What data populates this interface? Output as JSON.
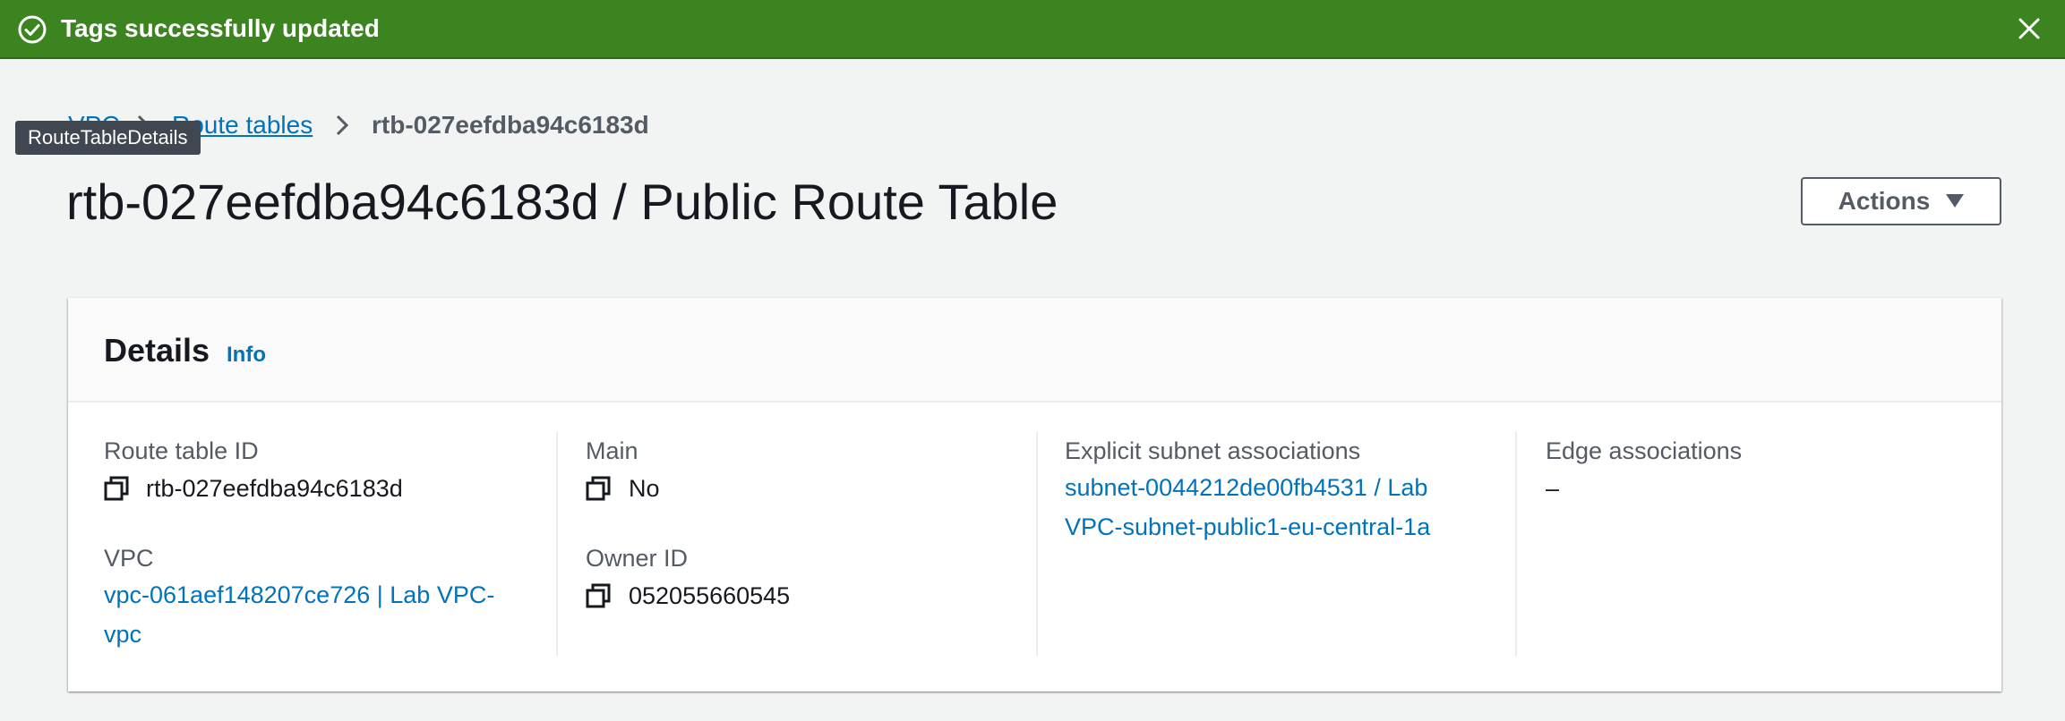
{
  "flash": {
    "message": "Tags successfully updated",
    "icon": "check-circle-icon",
    "close_icon": "close-icon",
    "color": "#3b841f"
  },
  "breadcrumb": {
    "items": [
      "VPC",
      "Route tables"
    ],
    "current": "rtb-027eefdba94c6183d"
  },
  "tooltip": {
    "text": "RouteTableDetails"
  },
  "page": {
    "title": "rtb-027eefdba94c6183d / Public Route Table",
    "actions_label": "Actions"
  },
  "details": {
    "title": "Details",
    "info_link": "Info",
    "route_table_id": {
      "label": "Route table ID",
      "value": "rtb-027eefdba94c6183d"
    },
    "vpc": {
      "label": "VPC",
      "line1": "vpc-061aef148207ce726 | Lab VPC-",
      "line2": "vpc"
    },
    "main": {
      "label": "Main",
      "value": "No"
    },
    "owner_id": {
      "label": "Owner ID",
      "value": "052055660545"
    },
    "explicit_subnet": {
      "label": "Explicit subnet associations",
      "line1": "subnet-0044212de00fb4531 / Lab",
      "line2": "VPC-subnet-public1-eu-central-1a"
    },
    "edge": {
      "label": "Edge associations",
      "value": "–"
    }
  },
  "colors": {
    "link": "#0073bb",
    "background": "#f2f3f3",
    "success": "#3b841f"
  }
}
